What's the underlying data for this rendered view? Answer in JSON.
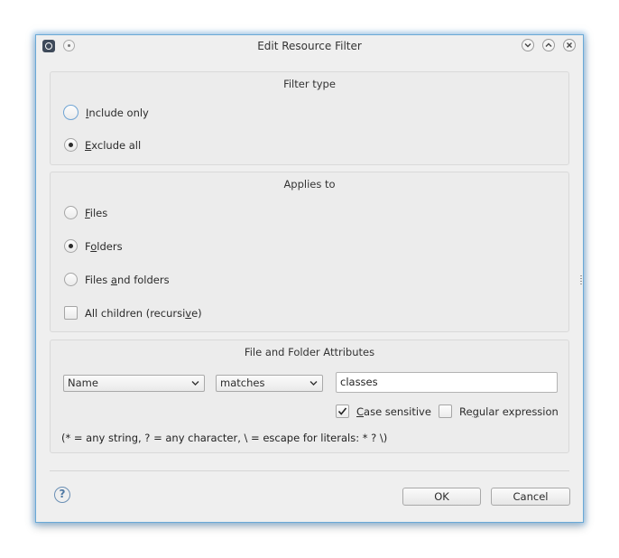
{
  "window": {
    "title": "Edit Resource Filter"
  },
  "filter_type": {
    "title": "Filter type",
    "options": [
      {
        "pre": "",
        "mnemonic": "I",
        "post": "nclude only",
        "selected": false,
        "focused": true
      },
      {
        "pre": "",
        "mnemonic": "E",
        "post": "xclude all",
        "selected": true,
        "focused": false
      }
    ]
  },
  "applies_to": {
    "title": "Applies to",
    "options": [
      {
        "pre": "",
        "mnemonic": "F",
        "post": "iles",
        "selected": false
      },
      {
        "pre": "F",
        "mnemonic": "o",
        "post": "lders",
        "selected": true
      },
      {
        "pre": "Files ",
        "mnemonic": "a",
        "post": "nd folders",
        "selected": false
      }
    ],
    "recursive": {
      "pre": "All children (recursi",
      "mnemonic": "v",
      "post": "e)",
      "checked": false
    }
  },
  "attributes": {
    "title": "File and Folder Attributes",
    "attribute_combo": "Name",
    "operator_combo": "matches",
    "pattern_value": "classes",
    "case_sensitive": {
      "pre": "",
      "mnemonic": "C",
      "post": "ase sensitive",
      "checked": true
    },
    "regex": {
      "pre": "Re",
      "mnemonic": "g",
      "post": "ular expression",
      "checked": false
    },
    "hint": "(* = any string, ? = any character, \\ = escape for literals: * ? \\)"
  },
  "buttons": {
    "ok": "OK",
    "cancel": "Cancel",
    "help": "?"
  },
  "colors": {
    "accent": "#6aa9d6",
    "background": "#efefef"
  }
}
